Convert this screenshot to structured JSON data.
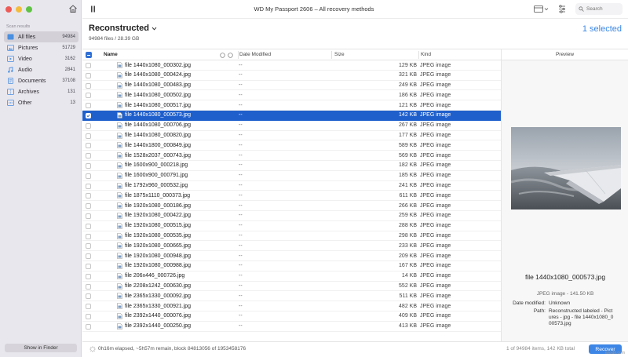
{
  "window": {
    "title": "WD My Passport 2606 – All recovery methods"
  },
  "sidebar": {
    "heading": "Scan results",
    "items": [
      {
        "label": "All files",
        "count": "94984",
        "icon": "all-files-icon",
        "active": true
      },
      {
        "label": "Pictures",
        "count": "51729",
        "icon": "pictures-icon"
      },
      {
        "label": "Video",
        "count": "3162",
        "icon": "video-icon"
      },
      {
        "label": "Audio",
        "count": "2841",
        "icon": "audio-icon"
      },
      {
        "label": "Documents",
        "count": "37108",
        "icon": "documents-icon"
      },
      {
        "label": "Archives",
        "count": "131",
        "icon": "archives-icon"
      },
      {
        "label": "Other",
        "count": "13",
        "icon": "other-icon"
      }
    ],
    "finder_button": "Show in Finder"
  },
  "search": {
    "placeholder": "Search"
  },
  "header": {
    "title": "Reconstructed",
    "subtitle": "94984 files / 28.39 GB",
    "selected": "1 selected"
  },
  "table": {
    "columns": {
      "name": "Name",
      "date": "Date Modified",
      "size": "Size",
      "kind": "Kind"
    },
    "rows": [
      {
        "name": "file 1440x1080_000302.jpg",
        "date": "--",
        "size": "129 KB",
        "kind": "JPEG image"
      },
      {
        "name": "file 1440x1080_000424.jpg",
        "date": "--",
        "size": "321 KB",
        "kind": "JPEG image"
      },
      {
        "name": "file 1440x1080_000483.jpg",
        "date": "--",
        "size": "249 KB",
        "kind": "JPEG image"
      },
      {
        "name": "file 1440x1080_000502.jpg",
        "date": "--",
        "size": "186 KB",
        "kind": "JPEG image"
      },
      {
        "name": "file 1440x1080_000517.jpg",
        "date": "--",
        "size": "121 KB",
        "kind": "JPEG image"
      },
      {
        "name": "file 1440x1080_000573.jpg",
        "date": "--",
        "size": "142 KB",
        "kind": "JPEG image",
        "selected": true
      },
      {
        "name": "file 1440x1080_000706.jpg",
        "date": "--",
        "size": "267 KB",
        "kind": "JPEG image"
      },
      {
        "name": "file 1440x1080_000820.jpg",
        "date": "--",
        "size": "177 KB",
        "kind": "JPEG image"
      },
      {
        "name": "file 1440x1800_000849.jpg",
        "date": "--",
        "size": "589 KB",
        "kind": "JPEG image"
      },
      {
        "name": "file 1528x2037_000743.jpg",
        "date": "--",
        "size": "569 KB",
        "kind": "JPEG image"
      },
      {
        "name": "file 1600x900_000218.jpg",
        "date": "--",
        "size": "182 KB",
        "kind": "JPEG image"
      },
      {
        "name": "file 1600x900_000791.jpg",
        "date": "--",
        "size": "185 KB",
        "kind": "JPEG image"
      },
      {
        "name": "file 1792x960_000532.jpg",
        "date": "--",
        "size": "241 KB",
        "kind": "JPEG image"
      },
      {
        "name": "file 1875x1110_000373.jpg",
        "date": "--",
        "size": "611 KB",
        "kind": "JPEG image"
      },
      {
        "name": "file 1920x1080_000186.jpg",
        "date": "--",
        "size": "266 KB",
        "kind": "JPEG image"
      },
      {
        "name": "file 1920x1080_000422.jpg",
        "date": "--",
        "size": "259 KB",
        "kind": "JPEG image"
      },
      {
        "name": "file 1920x1080_000515.jpg",
        "date": "--",
        "size": "288 KB",
        "kind": "JPEG image"
      },
      {
        "name": "file 1920x1080_000535.jpg",
        "date": "--",
        "size": "298 KB",
        "kind": "JPEG image"
      },
      {
        "name": "file 1920x1080_000665.jpg",
        "date": "--",
        "size": "233 KB",
        "kind": "JPEG image"
      },
      {
        "name": "file 1920x1080_000948.jpg",
        "date": "--",
        "size": "209 KB",
        "kind": "JPEG image"
      },
      {
        "name": "file 1920x1080_000988.jpg",
        "date": "--",
        "size": "167 KB",
        "kind": "JPEG image"
      },
      {
        "name": "file 206x446_000726.jpg",
        "date": "--",
        "size": "14 KB",
        "kind": "JPEG image"
      },
      {
        "name": "file 2208x1242_000630.jpg",
        "date": "--",
        "size": "552 KB",
        "kind": "JPEG image"
      },
      {
        "name": "file 2365x1330_000092.jpg",
        "date": "--",
        "size": "511 KB",
        "kind": "JPEG image"
      },
      {
        "name": "file 2365x1330_000921.jpg",
        "date": "--",
        "size": "482 KB",
        "kind": "JPEG image"
      },
      {
        "name": "file 2392x1440_000076.jpg",
        "date": "--",
        "size": "409 KB",
        "kind": "JPEG image"
      },
      {
        "name": "file 2392x1440_000250.jpg",
        "date": "--",
        "size": "413 KB",
        "kind": "JPEG image"
      }
    ]
  },
  "preview": {
    "header": "Preview",
    "filename": "file 1440x1080_000573.jpg",
    "kind": "JPEG image - 141.50 KB",
    "date_label": "Date modified:",
    "date_value": "Unknown",
    "path_label": "Path:",
    "path_lines": [
      "Reconstructed labeled - Pict",
      "ures - jpg - file 1440x1080_0",
      "00573.jpg"
    ]
  },
  "status": {
    "progress": "0h16m elapsed, ~5h57m remain, block 84813056 of 1953458176",
    "summary": "1 of 94984 items, 142 KB total",
    "recover_button": "Recover"
  },
  "watermark": "wsxdn.com",
  "colors": {
    "accent": "#3b87e4",
    "selection": "#1f5fcc",
    "sidebar_bg": "#e9e7ee"
  }
}
